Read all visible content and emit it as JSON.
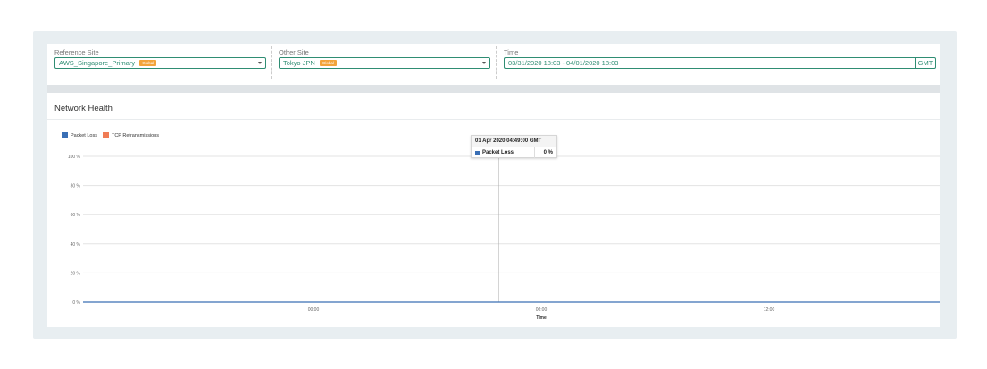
{
  "filters": {
    "reference_site": {
      "label": "Reference Site",
      "value": "AWS_Singapore_Primary",
      "badge": "Global"
    },
    "other_site": {
      "label": "Other Site",
      "value": "Tokyo JPN",
      "badge": "Global"
    },
    "time": {
      "label": "Time",
      "value": "03/31/2020 18:03 - 04/01/2020 18:03",
      "timezone": "GMT"
    }
  },
  "panel": {
    "title": "Network Health"
  },
  "chart_data": {
    "type": "line",
    "title": "",
    "xlabel": "Time",
    "ylabel": "",
    "ylim": [
      0,
      100
    ],
    "y_ticks": [
      "100 %",
      "80 %",
      "60 %",
      "40 %",
      "20 %",
      "0 %"
    ],
    "x_ticks": [
      "00:00",
      "06:00",
      "12:00"
    ],
    "grid": true,
    "legend_position": "top-left",
    "series": [
      {
        "name": "Packet Loss",
        "color": "#3a6fb5",
        "values": [
          0,
          0,
          0,
          0,
          0
        ]
      },
      {
        "name": "TCP Retransmissions",
        "color": "#f07c55",
        "values": []
      }
    ],
    "tooltip": {
      "header": "01 Apr 2020 04:49:00 GMT",
      "series_name": "Packet Loss",
      "value": "0 %"
    }
  },
  "colors": {
    "accent": "#2f8d73",
    "badge": "#f3a43b",
    "packet_loss": "#3a6fb5",
    "tcp_retransmissions": "#f07c55"
  }
}
